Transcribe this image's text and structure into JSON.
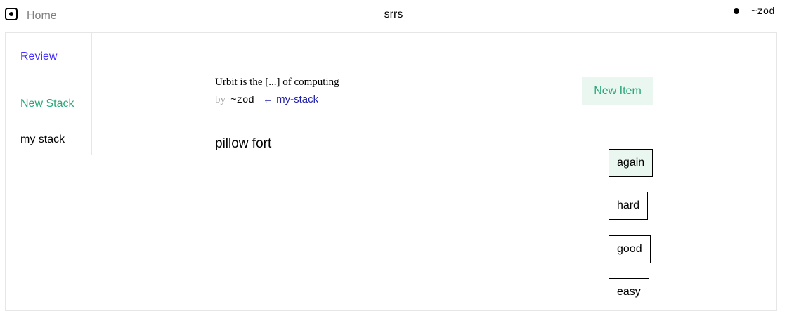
{
  "header": {
    "home_label": "Home",
    "app_title": "srrs",
    "user": "~zod"
  },
  "sidebar": {
    "items": [
      {
        "label": "Review"
      },
      {
        "label": "New Stack"
      },
      {
        "label": "my stack"
      }
    ]
  },
  "main": {
    "item_title": "Urbit is the [...] of computing",
    "by": "by",
    "author": "~zod",
    "back_link": "← my-stack",
    "new_item_label": "New Item",
    "card_content": "pillow fort",
    "grades": [
      "again",
      "hard",
      "good",
      "easy"
    ]
  },
  "colors": {
    "review": "#4330fc",
    "accent_green": "#2aa779",
    "green_bg": "#eaf7f1",
    "back_link": "#1f1fa8"
  }
}
